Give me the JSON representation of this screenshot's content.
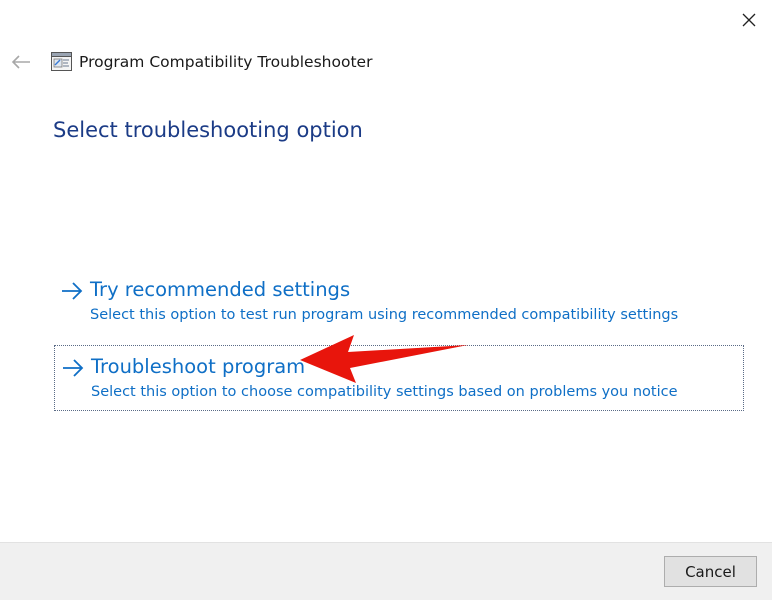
{
  "window": {
    "title": "Program Compatibility Troubleshooter",
    "close_icon": "close-icon",
    "back_icon": "back-arrow-icon",
    "app_icon": "troubleshooter-app-icon"
  },
  "page": {
    "heading": "Select troubleshooting option"
  },
  "options": [
    {
      "title": "Try recommended settings",
      "description": "Select this option to test run program using recommended compatibility settings",
      "icon": "arrow-right-icon",
      "focused": false
    },
    {
      "title": "Troubleshoot program",
      "description": "Select this option to choose compatibility settings based on problems you notice",
      "icon": "arrow-right-icon",
      "focused": true
    }
  ],
  "annotation": {
    "icon": "red-pointer-arrow",
    "color": "#e8150c"
  },
  "footer": {
    "cancel_label": "Cancel"
  },
  "colors": {
    "heading": "#1b3b86",
    "link": "#0f6fc6",
    "footer_bg": "#f0f0f0"
  }
}
